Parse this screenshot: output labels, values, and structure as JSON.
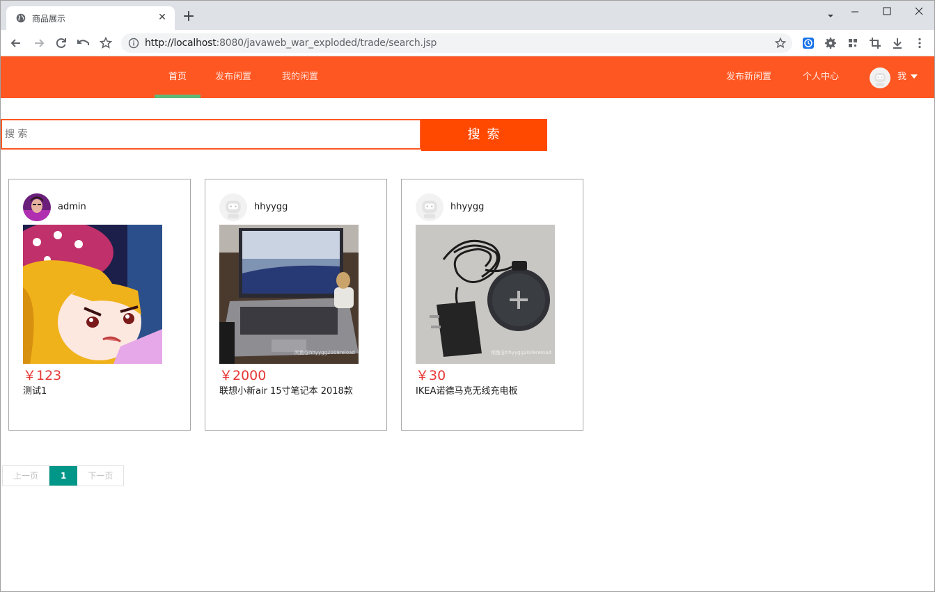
{
  "browser": {
    "tab_title": "商品展示",
    "url_host": "http://localhost",
    "url_rest": ":8080/javaweb_war_exploded/trade/search.jsp"
  },
  "nav": {
    "items": [
      {
        "label": "首页",
        "active": true
      },
      {
        "label": "发布闲置",
        "active": false
      },
      {
        "label": "我的闲置",
        "active": false
      }
    ],
    "publish_new": "发布新闲置",
    "personal_center": "个人中心",
    "me": "我",
    "bg_color": "#ff5722"
  },
  "search": {
    "placeholder": "搜  索",
    "button": "搜  索"
  },
  "products": [
    {
      "user": "admin",
      "avatar": "photo-avatar",
      "image": "anime-girl-image",
      "price": "￥123",
      "title": "测试1"
    },
    {
      "user": "hhyygg",
      "avatar": "robot-avatar",
      "image": "laptop-image",
      "price": "￥2000",
      "title": "联想小新air 15寸笔记本 2018款"
    },
    {
      "user": "hhyygg",
      "avatar": "robot-avatar",
      "image": "wireless-charger-image",
      "price": "￥30",
      "title": "IKEA诺德马克无线充电板"
    }
  ],
  "pagination": {
    "prev": "上一页",
    "current": "1",
    "next": "下一页",
    "current_color": "#009688"
  }
}
